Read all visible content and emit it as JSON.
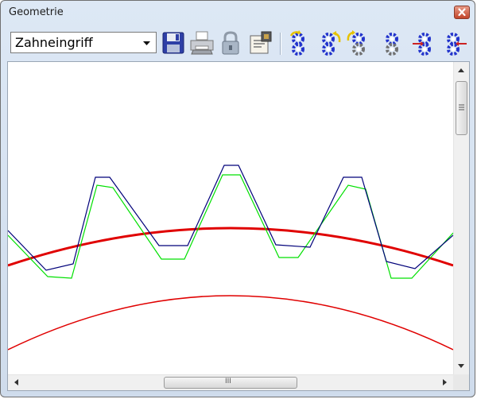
{
  "window": {
    "title": "Geometrie"
  },
  "toolbar": {
    "view_select": {
      "value": "Zahneingriff"
    },
    "buttons": [
      {
        "name": "save-button",
        "icon": "floppy-disk-icon"
      },
      {
        "name": "print-button",
        "icon": "printer-icon"
      },
      {
        "name": "lock-button",
        "icon": "padlock-icon"
      },
      {
        "name": "properties-button",
        "icon": "properties-icon"
      },
      {
        "name": "gear-rotate-left-button",
        "icon": "gear-rotate-left-icon"
      },
      {
        "name": "gear-rotate-right-button",
        "icon": "gear-rotate-right-icon"
      },
      {
        "name": "gear-pair-rotate-button",
        "icon": "gear-pair-rotate-icon"
      },
      {
        "name": "gear-pair-button",
        "icon": "gear-pair-icon"
      },
      {
        "name": "gear-move-right-button",
        "icon": "gear-move-right-icon"
      },
      {
        "name": "gear-move-left-button",
        "icon": "gear-move-left-icon"
      }
    ]
  },
  "canvas": {
    "colors": {
      "tooth_profile_a": "#00007a",
      "tooth_profile_b": "#00e000",
      "pitch_circle": "#e00000",
      "root_circle": "#e00000"
    }
  },
  "scrollbars": {
    "horizontal_grip": "III"
  }
}
